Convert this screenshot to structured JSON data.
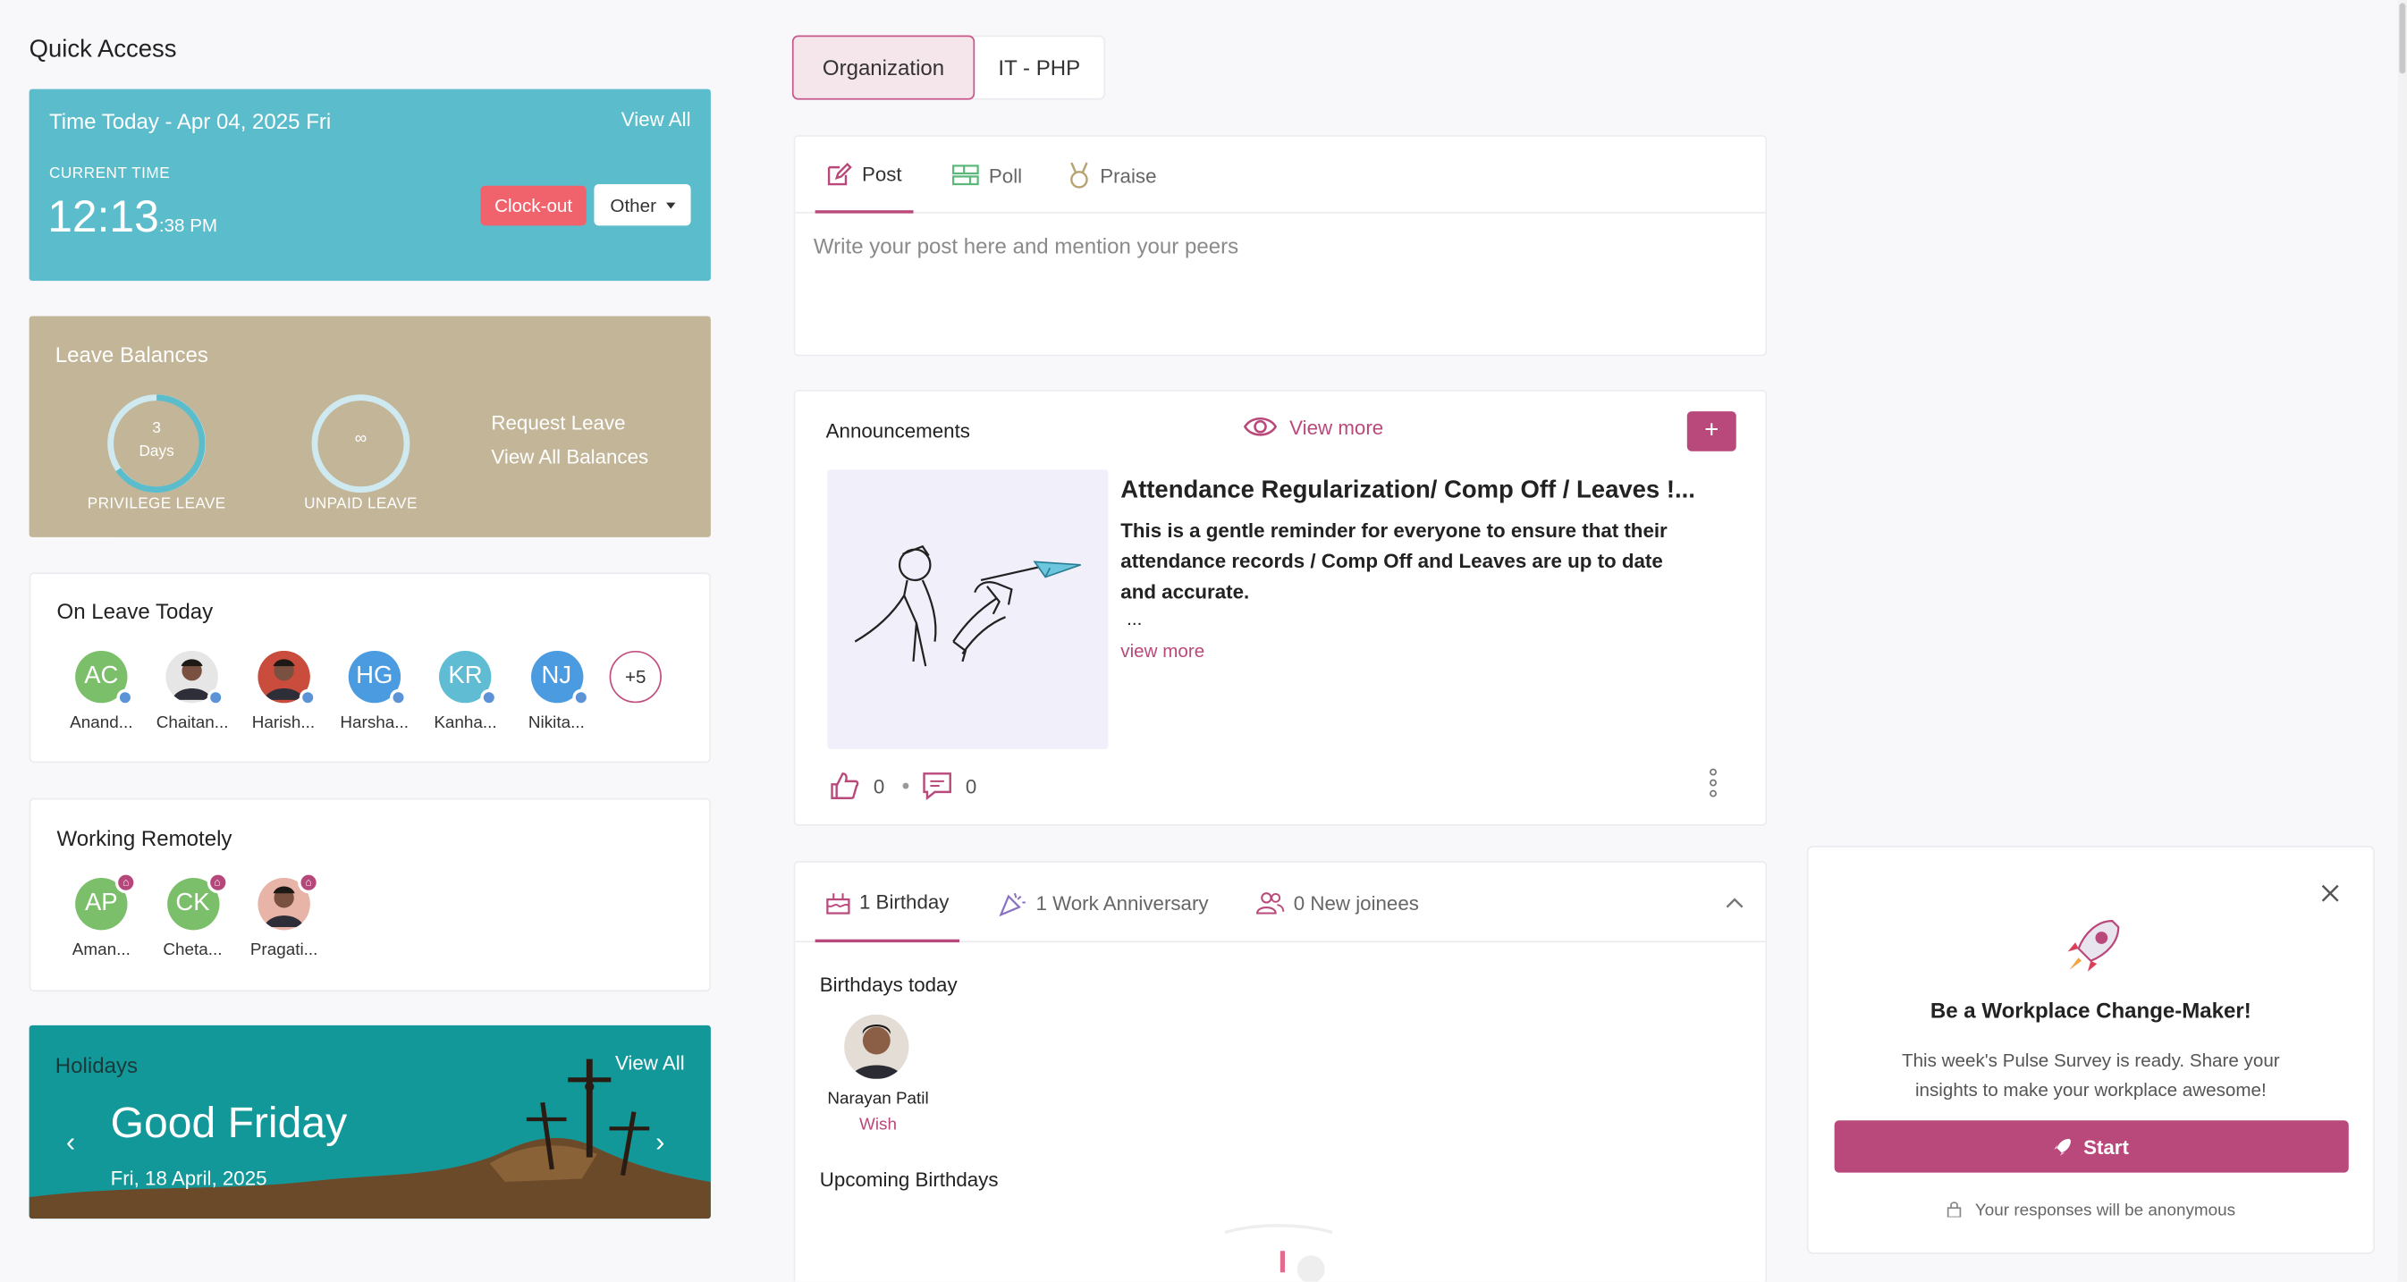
{
  "quick_access": {
    "title": "Quick Access"
  },
  "time_today": {
    "title": "Time Today - Apr 04, 2025 Fri",
    "view_all": "View All",
    "current_time_label": "CURRENT TIME",
    "time_main": "12:13",
    "time_suffix": ":38 PM",
    "clock_out_label": "Clock-out",
    "other_label": "Other",
    "bg_color": "#5bbccb"
  },
  "leave_balances": {
    "title": "Leave Balances",
    "privilege": {
      "value": "3",
      "unit": "Days",
      "label": "PRIVILEGE LEAVE"
    },
    "unpaid": {
      "value": "∞",
      "label": "UNPAID LEAVE"
    },
    "request_leave": "Request Leave",
    "view_all_balances": "View All Balances",
    "bg_color": "#c2b598"
  },
  "on_leave_today": {
    "title": "On Leave Today",
    "people": [
      {
        "initials": "AC",
        "name": "Anand...",
        "color": "#7bbf6a"
      },
      {
        "initials": "",
        "name": "Chaitan...",
        "color": "#e6e6e6"
      },
      {
        "initials": "",
        "name": "Harish...",
        "color": "#c94c3c"
      },
      {
        "initials": "HG",
        "name": "Harsha...",
        "color": "#4b9be0"
      },
      {
        "initials": "KR",
        "name": "Kanha...",
        "color": "#5fbcd3"
      },
      {
        "initials": "NJ",
        "name": "Nikita...",
        "color": "#4b9be0"
      }
    ],
    "more": "+5"
  },
  "working_remotely": {
    "title": "Working Remotely",
    "people": [
      {
        "initials": "AP",
        "name": "Aman...",
        "color": "#7bbf6a"
      },
      {
        "initials": "CK",
        "name": "Cheta...",
        "color": "#7bbf6a"
      },
      {
        "initials": "",
        "name": "Pragati...",
        "color": "#e8b4a8"
      }
    ]
  },
  "holidays": {
    "title": "Holidays",
    "view_all": "View All",
    "name": "Good Friday",
    "date": "Fri, 18 April, 2025",
    "bg_color": "#13989a"
  },
  "org_tabs": [
    {
      "label": "Organization",
      "active": true
    },
    {
      "label": "IT - PHP",
      "active": false
    }
  ],
  "composer": {
    "tabs": [
      {
        "label": "Post",
        "icon": "edit-icon",
        "active": true
      },
      {
        "label": "Poll",
        "icon": "poll-icon",
        "active": false
      },
      {
        "label": "Praise",
        "icon": "medal-icon",
        "active": false
      }
    ],
    "placeholder": "Write your post here and mention your peers"
  },
  "announcements": {
    "title": "Announcements",
    "view_more": "View more",
    "add_label": "+",
    "item": {
      "title": "Attendance Regularization/ Comp Off / Leaves !...",
      "body": "This is a gentle reminder for everyone to ensure that their attendance records / Comp Off and Leaves are up to date and accurate.",
      "ellipsis": "...",
      "view_more": "view more",
      "likes": "0",
      "comments": "0"
    }
  },
  "celebrations": {
    "tabs": [
      {
        "label": "1 Birthday",
        "icon": "cake-icon",
        "active": true
      },
      {
        "label": "1 Work Anniversary",
        "icon": "party-icon",
        "active": false
      },
      {
        "label": "0 New joinees",
        "icon": "users-icon",
        "active": false
      }
    ],
    "birthdays_today": "Birthdays today",
    "person": {
      "name": "Narayan Patil",
      "action": "Wish"
    },
    "upcoming": "Upcoming Birthdays"
  },
  "survey": {
    "title": "Be a Workplace Change-Maker!",
    "body": "This week's Pulse Survey is ready. Share your insights to make your workplace awesome!",
    "start_label": "Start",
    "anon_note": "Your responses will be anonymous",
    "accent": "#b9497b"
  }
}
